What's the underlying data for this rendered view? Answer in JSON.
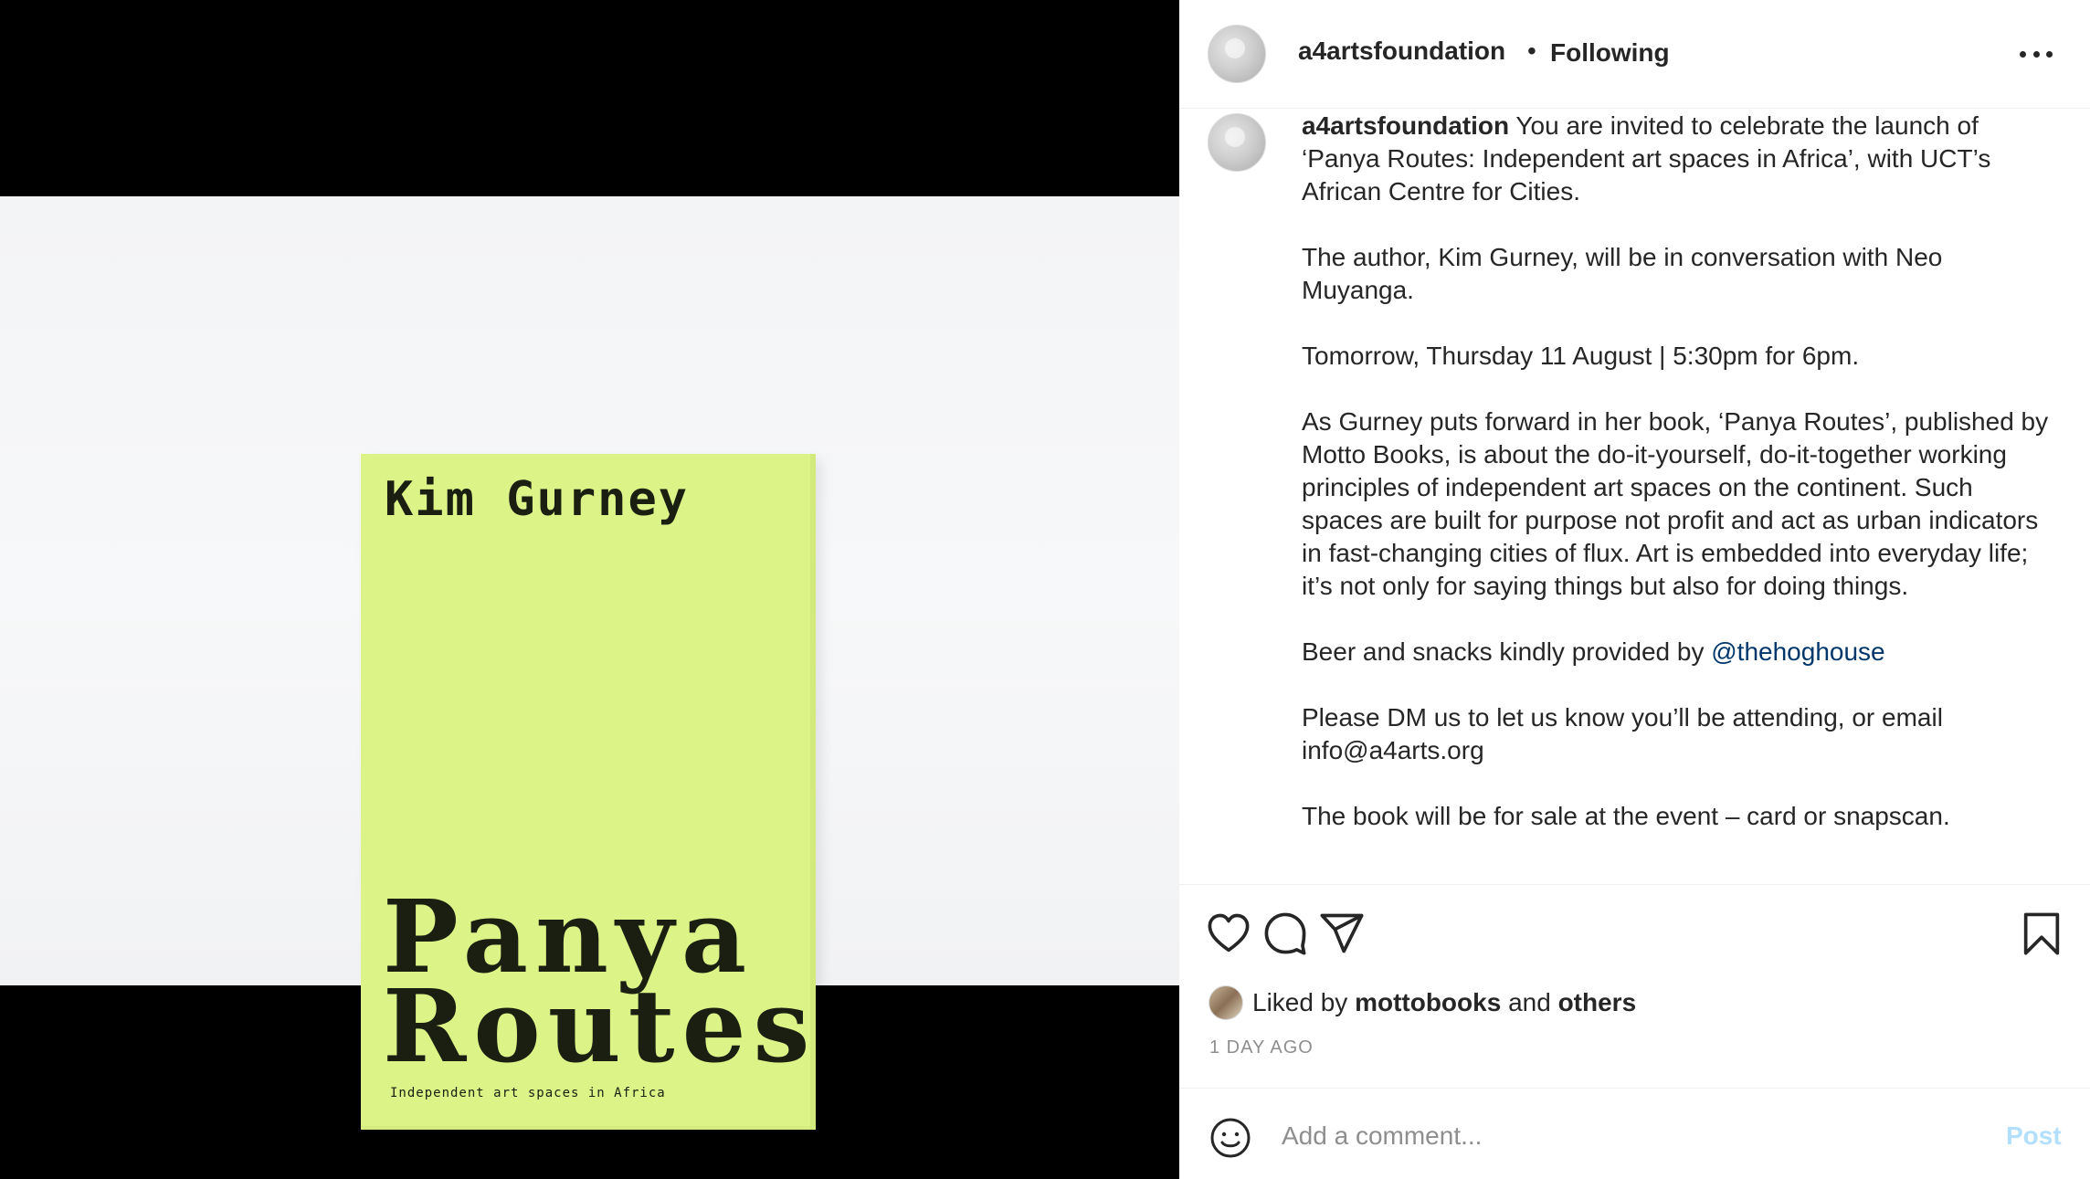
{
  "post": {
    "media": {
      "book_author": "Kim Gurney",
      "book_title_line1": "Panya",
      "book_title_line2": "Routes",
      "book_subtitle": "Independent art spaces in Africa"
    },
    "header": {
      "username": "a4artsfoundation",
      "separator": "•",
      "follow_status": "Following",
      "more_icon": "more-options-icon"
    },
    "caption": {
      "owner": "a4artsfoundation",
      "p1": "You are invited to celebrate the launch of ‘Panya Routes: Independent art spaces in Africa’, with UCT’s African Centre for Cities.",
      "p2": "The author, Kim Gurney, will be in conversation with Neo Muyanga.",
      "p3": "Tomorrow, Thursday 11 August | 5:30pm for 6pm.",
      "p4": "As Gurney puts forward in her book, ‘Panya Routes’, published by Motto Books, is about the do-it-yourself, do-it-together working principles of independent art spaces on the continent. Such spaces are built for purpose not profit and act as urban indicators in fast-changing cities of flux. Art is embedded into everyday life; it’s not only for saying things but also for doing things.",
      "p5_prefix": "Beer and snacks kindly provided by ",
      "p5_mention": "@thehoghouse",
      "p6": "Please DM us to let us know you’ll be attending, or email info@a4arts.org",
      "p7": "The book will be for sale at the event – card or snapscan."
    },
    "actions": {
      "like_icon": "heart-icon",
      "comment_icon": "comment-icon",
      "share_icon": "share-icon",
      "save_icon": "bookmark-icon"
    },
    "likes": {
      "prefix": "Liked by",
      "user": "mottobooks",
      "joiner": "and",
      "others": "others"
    },
    "timestamp": "1 DAY AGO",
    "comment": {
      "placeholder": "Add a comment...",
      "post_label": "Post",
      "emoji_icon": "emoji-icon"
    },
    "colors": {
      "book_cover": "#dcf387",
      "mention": "#00376b",
      "post_disabled": "#b2dffc"
    }
  }
}
